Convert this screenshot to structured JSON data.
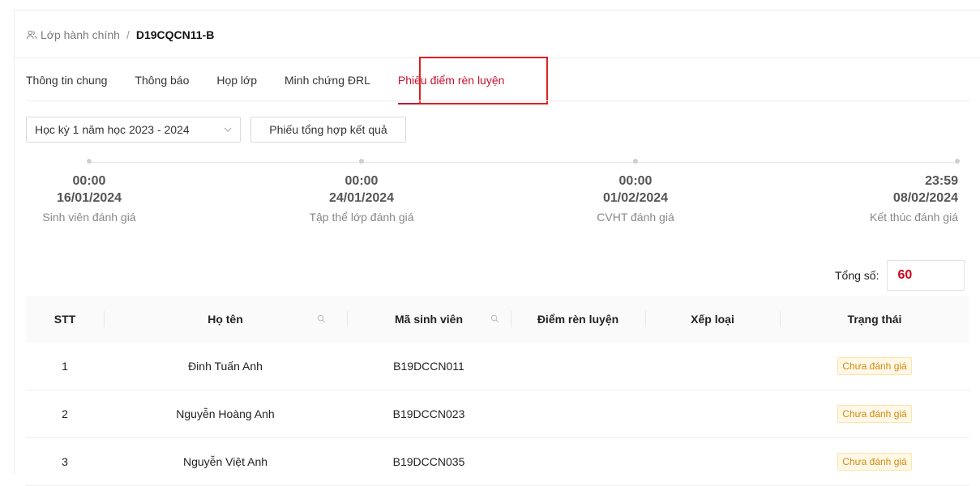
{
  "breadcrumb": {
    "parent": "Lớp hành chính",
    "separator": "/",
    "current": "D19CQCN11-B"
  },
  "tabs": [
    {
      "label": "Thông tin chung"
    },
    {
      "label": "Thông báo"
    },
    {
      "label": "Họp lớp"
    },
    {
      "label": "Minh chứng ĐRL"
    },
    {
      "label": "Phiếu điểm rèn luyện",
      "active": true
    }
  ],
  "filters": {
    "semester": "Học kỳ 1 năm học 2023 - 2024",
    "summary_button": "Phiếu tổng hợp kết quả"
  },
  "timeline": [
    {
      "time": "00:00",
      "date": "16/01/2024",
      "label": "Sinh viên đánh giá"
    },
    {
      "time": "00:00",
      "date": "24/01/2024",
      "label": "Tập thể lớp đánh giá"
    },
    {
      "time": "00:00",
      "date": "01/02/2024",
      "label": "CVHT đánh giá"
    },
    {
      "time": "23:59",
      "date": "08/02/2024",
      "label": "Kết thúc đánh giá"
    }
  ],
  "total": {
    "label": "Tổng số:",
    "value": "60"
  },
  "table": {
    "columns": [
      "STT",
      "Họ tên",
      "Mã sinh viên",
      "Điểm rèn luyện",
      "Xếp loại",
      "Trạng thái"
    ],
    "rows": [
      {
        "stt": "1",
        "name": "Đinh Tuấn Anh",
        "id": "B19DCCN011",
        "score": "",
        "rank": "",
        "status": "Chưa đánh giá"
      },
      {
        "stt": "2",
        "name": "Nguyễn Hoàng Anh",
        "id": "B19DCCN023",
        "score": "",
        "rank": "",
        "status": "Chưa đánh giá"
      },
      {
        "stt": "3",
        "name": "Nguyễn Việt Anh",
        "id": "B19DCCN035",
        "score": "",
        "rank": "",
        "status": "Chưa đánh giá"
      }
    ]
  },
  "colors": {
    "accent": "#c8102e",
    "total_value": "#d0021b",
    "badge_text": "#d4880f",
    "badge_bg": "#fff8e6"
  },
  "icons": {
    "breadcrumb": "users-icon",
    "select": "chevron-down-icon",
    "search": "search-icon"
  }
}
